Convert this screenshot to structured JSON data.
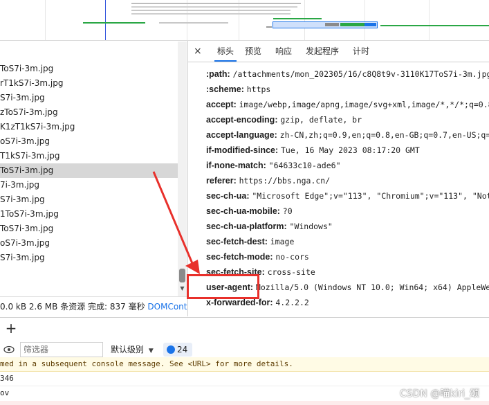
{
  "request_list": {
    "rows": [
      "ToS7i-3m.jpg",
      "rT1kS7i-3m.jpg",
      "S7i-3m.jpg",
      "zToS7i-3m.jpg",
      "K1zT1kS7i-3m.jpg",
      "oS7i-3m.jpg",
      "T1kS7i-3m.jpg",
      "ToS7i-3m.jpg",
      "7i-3m.jpg",
      "S7i-3m.jpg",
      "1ToS7i-3m.jpg",
      "ToS7i-3m.jpg",
      "oS7i-3m.jpg",
      "S7i-3m.jpg"
    ],
    "selected_index": 7
  },
  "status_bar": {
    "text": "0.0 kB  2.6 MB 条资源  完成:  837  毫秒",
    "link": "DOMConte"
  },
  "panel": {
    "close_icon": "×",
    "tabs": [
      {
        "label": "标头",
        "active": true
      },
      {
        "label": "预览",
        "active": false
      },
      {
        "label": "响应",
        "active": false
      },
      {
        "label": "发起程序",
        "active": false
      },
      {
        "label": "计时",
        "active": false
      }
    ]
  },
  "headers": [
    {
      "name": ":path:",
      "value": "/attachments/mon_202305/16/c8Q8t9v-3110K17ToS7i-3m.jpg"
    },
    {
      "name": ":scheme:",
      "value": "https"
    },
    {
      "name": "accept:",
      "value": "image/webp,image/apng,image/svg+xml,image/*,*/*;q=0.8"
    },
    {
      "name": "accept-encoding:",
      "value": "gzip, deflate, br"
    },
    {
      "name": "accept-language:",
      "value": "zh-CN,zh;q=0.9,en;q=0.8,en-GB;q=0.7,en-US;q=0.6"
    },
    {
      "name": "if-modified-since:",
      "value": "Tue, 16 May 2023 08:17:20 GMT"
    },
    {
      "name": "if-none-match:",
      "value": "\"64633c10-ade6\""
    },
    {
      "name": "referer:",
      "value": "https://bbs.nga.cn/"
    },
    {
      "name": "sec-ch-ua:",
      "value": "\"Microsoft Edge\";v=\"113\", \"Chromium\";v=\"113\", \"Not-A"
    },
    {
      "name": "sec-ch-ua-mobile:",
      "value": "?0"
    },
    {
      "name": "sec-ch-ua-platform:",
      "value": "\"Windows\""
    },
    {
      "name": "sec-fetch-dest:",
      "value": "image"
    },
    {
      "name": "sec-fetch-mode:",
      "value": "no-cors"
    },
    {
      "name": "sec-fetch-site:",
      "value": "cross-site"
    },
    {
      "name": "user-agent:",
      "value": "Mozilla/5.0 (Windows NT 10.0; Win64; x64) AppleWebKit"
    },
    {
      "name": "x-forwarded-for:",
      "value": "4.2.2.2"
    }
  ],
  "bottom": {
    "add_icon": "+",
    "filter_placeholder": "筛选器",
    "level_label": "默认级别",
    "issues_count": "24"
  },
  "console": {
    "lines": [
      "med in a subsequent console message. See <URL> for more details.",
      "346",
      "ov"
    ]
  },
  "watermark": "CSDN @喵kiri_颂",
  "colors": {
    "accent_blue": "#1a73e8",
    "annotation_red": "#e8302b",
    "selected_row": "#d7d7d7",
    "timeline_green": "#2aa745",
    "timeline_blue": "#1a73e8"
  }
}
